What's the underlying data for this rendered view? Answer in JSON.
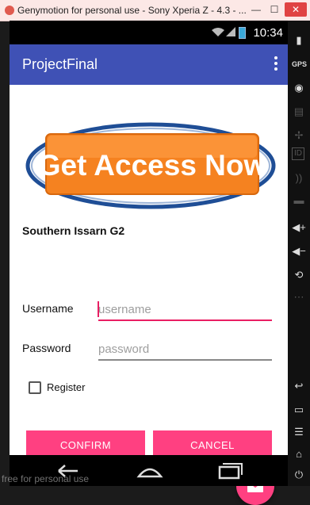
{
  "window": {
    "title": "Genymotion for personal use - Sony Xperia Z - 4.3 - ...",
    "watermark": "free for personal use"
  },
  "status_bar": {
    "time": "10:34"
  },
  "app_bar": {
    "title": "ProjectFinal",
    "overflow_icon": "more-vert-icon"
  },
  "banner": {
    "text": "Get Access Now"
  },
  "form": {
    "section_title": "Southern Issarn G2",
    "username_label": "Username",
    "username_placeholder": "username",
    "password_label": "Password",
    "password_placeholder": "password",
    "register_label": "Register",
    "register_checked": false
  },
  "buttons": {
    "confirm": "CONFIRM",
    "cancel": "CANCEL"
  },
  "fab": {
    "icon": "email-icon"
  },
  "colors": {
    "primary": "#3f51b5",
    "accent": "#ff4081",
    "banner_orange": "#f58220",
    "banner_blue": "#1f4e96"
  },
  "sidebar": {
    "gps_label": "GPS",
    "id_label": "ID"
  }
}
